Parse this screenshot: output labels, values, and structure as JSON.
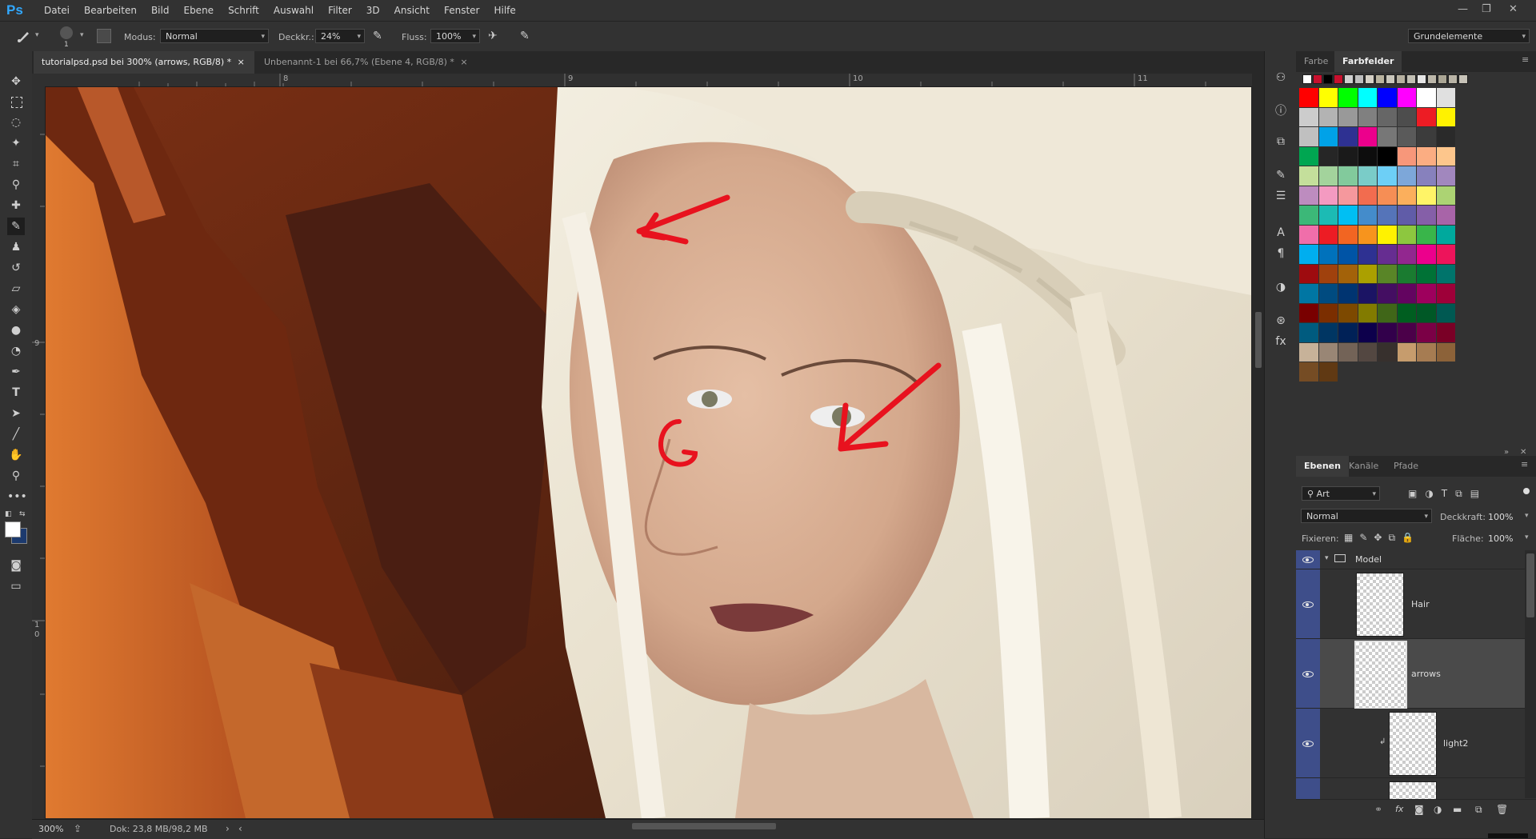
{
  "app": {
    "logo": "Ps"
  },
  "menu": [
    "Datei",
    "Bearbeiten",
    "Bild",
    "Ebene",
    "Schrift",
    "Auswahl",
    "Filter",
    "3D",
    "Ansicht",
    "Fenster",
    "Hilfe"
  ],
  "options": {
    "brush_size": "1",
    "modus_label": "Modus:",
    "modus_value": "Normal",
    "deckkraft_label": "Deckkr.:",
    "deckkraft_value": "24%",
    "fluss_label": "Fluss:",
    "fluss_value": "100%",
    "workspace": "Grundelemente"
  },
  "tabs": [
    {
      "label": "tutorialpsd.psd bei 300% (arrows, RGB/8) *",
      "close": "×"
    },
    {
      "label": "Unbenannt-1 bei 66,7% (Ebene 4, RGB/8) *",
      "close": "×"
    }
  ],
  "ruler": {
    "top": [
      "8",
      "9",
      "10",
      "11"
    ],
    "left": [
      "9",
      "1",
      "0"
    ]
  },
  "status": {
    "zoom": "300%",
    "doc": "Dok: 23,8 MB/98,2 MB",
    "arrow": "›",
    "nav": "‹"
  },
  "swatches_panel": {
    "tabs": [
      "Farbe",
      "Farbfelder"
    ],
    "recent": [
      "#ffffff",
      "#c8102e",
      "#000000",
      "#c8102e",
      "#cfcfcf",
      "#bdbdbd",
      "#d5d0c5",
      "#b9b39f",
      "#c9c6bb",
      "#b6b0a0",
      "#c2bfb4",
      "#e6e6e6",
      "#bcb7aa",
      "#aaa594",
      "#b9b4a6",
      "#c7c3b8"
    ],
    "rows": [
      [
        "#ff0000",
        "#ffff00",
        "#00ff00",
        "#00ffff",
        "#0000ff",
        "#ff00ff",
        "#ffffff",
        "#e0e0e0"
      ],
      [
        "#cccccc",
        "#b3b3b3",
        "#999999",
        "#808080",
        "#666666",
        "#4d4d4d",
        "#ed1c24",
        "#fff200"
      ],
      [
        "#c0c0c0",
        "#00a2e8",
        "#2e3192",
        "#ec008c",
        "#777777",
        "#5a5a5a",
        "#3c3c3c",
        "#2a2a2a"
      ],
      [
        "#00a651",
        "#262626",
        "#1a1a1a",
        "#0d0d0d",
        "#000000",
        "#f7977a",
        "#fbad82",
        "#fdc68c"
      ],
      [
        "#c4df9b",
        "#a3d39c",
        "#82ca9c",
        "#7accc8",
        "#6dcff6",
        "#7da7d9",
        "#8781bd",
        "#a187be"
      ],
      [
        "#bd8cbf",
        "#f49ac1",
        "#f5989d",
        "#f26c4f",
        "#f68e55",
        "#fbaf5c",
        "#fff467",
        "#acd373"
      ],
      [
        "#3cb878",
        "#1cbbb4",
        "#00bff3",
        "#448ccb",
        "#5574b9",
        "#605ca8",
        "#855fa8",
        "#a864a8"
      ],
      [
        "#f06eaa",
        "#ed1c24",
        "#f26522",
        "#f7941d",
        "#fff200",
        "#8dc73f",
        "#39b54a",
        "#00a99d"
      ],
      [
        "#00aeef",
        "#0072bc",
        "#0054a6",
        "#2e3192",
        "#662d91",
        "#92278f",
        "#ec008c",
        "#ed145b"
      ],
      [
        "#9e0b0f",
        "#a0410d",
        "#a36209",
        "#aba000",
        "#598527",
        "#1a7b30",
        "#007236",
        "#00746b"
      ],
      [
        "#0076a3",
        "#004b80",
        "#003471",
        "#1b1464",
        "#440e62",
        "#630460",
        "#9e005d",
        "#9e0039"
      ],
      [
        "#790000",
        "#7b2e00",
        "#7d4900",
        "#827b00",
        "#406618",
        "#005e20",
        "#005826",
        "#005952"
      ],
      [
        "#005b7f",
        "#003663",
        "#002157",
        "#0d004c",
        "#32004b",
        "#4b0049",
        "#7b0046",
        "#7a0026"
      ],
      [
        "#c7b299",
        "#998675",
        "#736357",
        "#534741",
        "#37302d",
        "#c69c6d",
        "#a67c52",
        "#8c6239"
      ],
      [
        "#754c24",
        "#603913"
      ]
    ]
  },
  "layers_panel": {
    "tabs": [
      "Ebenen",
      "Kanäle",
      "Pfade"
    ],
    "filter": "Art",
    "blend_mode": "Normal",
    "deckkraft_label": "Deckkraft:",
    "deckkraft_value": "100%",
    "fixieren_label": "Fixieren:",
    "flaeche_label": "Fläche:",
    "flaeche_value": "100%",
    "group_name": "Model",
    "layers": [
      "Hair",
      "arrows",
      "light2"
    ]
  },
  "colors": {
    "accent": "#31a8ff",
    "eye_column": "#3e4e8a",
    "arrows": "#e8121e",
    "selected_row": "#4a4a4a"
  },
  "icons": {
    "tools": [
      "move-icon",
      "marquee-icon",
      "lasso-icon",
      "magic-wand-icon",
      "crop-icon",
      "eyedropper-icon",
      "healing-icon",
      "brush-icon",
      "stamp-icon",
      "history-brush-icon",
      "eraser-icon",
      "bucket-icon",
      "blur-icon",
      "dodge-icon",
      "pen-icon",
      "type-icon",
      "path-select-icon",
      "line-icon",
      "hand-icon",
      "zoom-icon",
      "more-icon"
    ]
  }
}
